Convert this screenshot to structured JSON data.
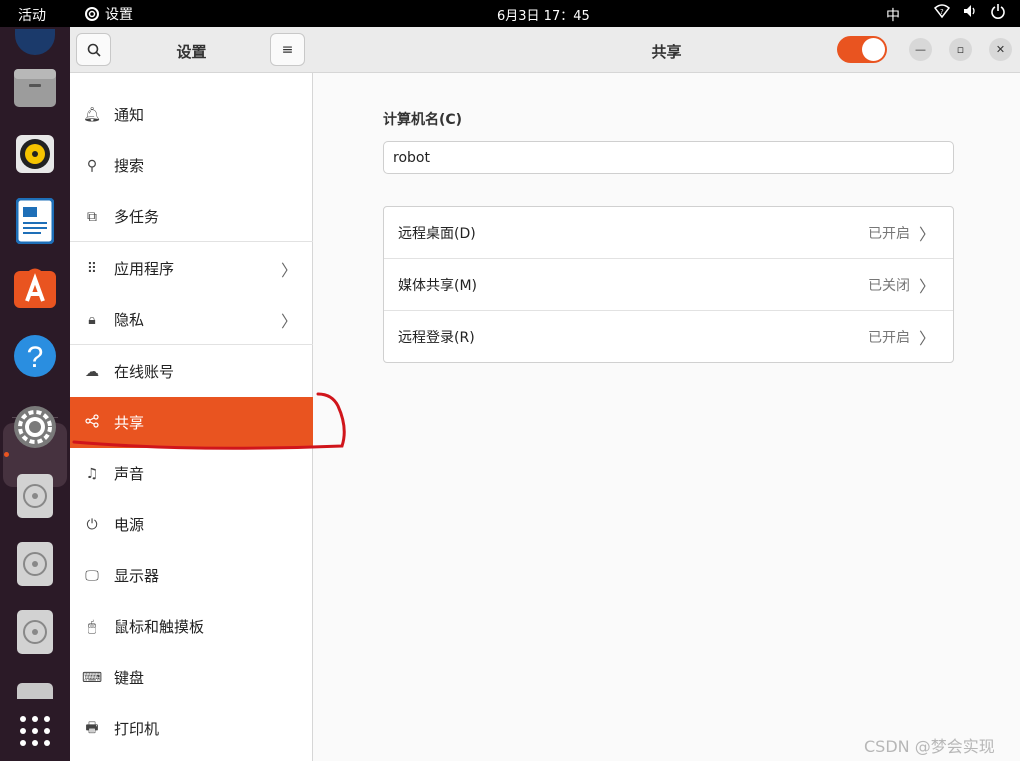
{
  "topbar": {
    "activities": "活动",
    "app_name": "设置",
    "clock": "6月3日  17：45",
    "ime": "中"
  },
  "sidebar": {
    "title": "设置",
    "items": [
      {
        "label": "通知",
        "icon": "bell-icon"
      },
      {
        "label": "搜索",
        "icon": "search-icon"
      },
      {
        "label": "多任务",
        "icon": "multitask-icon"
      },
      {
        "label": "应用程序",
        "icon": "grid-icon"
      },
      {
        "label": "隐私",
        "icon": "lock-icon"
      },
      {
        "label": "在线账号",
        "icon": "cloud-icon"
      },
      {
        "label": "共享",
        "icon": "share-icon"
      },
      {
        "label": "声音",
        "icon": "music-note-icon"
      },
      {
        "label": "电源",
        "icon": "power-icon"
      },
      {
        "label": "显示器",
        "icon": "display-icon"
      },
      {
        "label": "鼠标和触摸板",
        "icon": "mouse-icon"
      },
      {
        "label": "键盘",
        "icon": "keyboard-icon"
      },
      {
        "label": "打印机",
        "icon": "printer-icon"
      }
    ]
  },
  "main": {
    "title": "共享",
    "sharing_enabled": true,
    "computer_name_label": "计算机名(C)",
    "computer_name_value": "robot",
    "rows": [
      {
        "label": "远程桌面(D)",
        "status": "已开启"
      },
      {
        "label": "媒体共享(M)",
        "status": "已关闭"
      },
      {
        "label": "远程登录(R)",
        "status": "已开启"
      }
    ]
  },
  "watermark": "CSDN @梦会实现",
  "colors": {
    "accent": "#e95420",
    "dock_bg": "#2b1a27",
    "annotation": "#d0151b"
  }
}
